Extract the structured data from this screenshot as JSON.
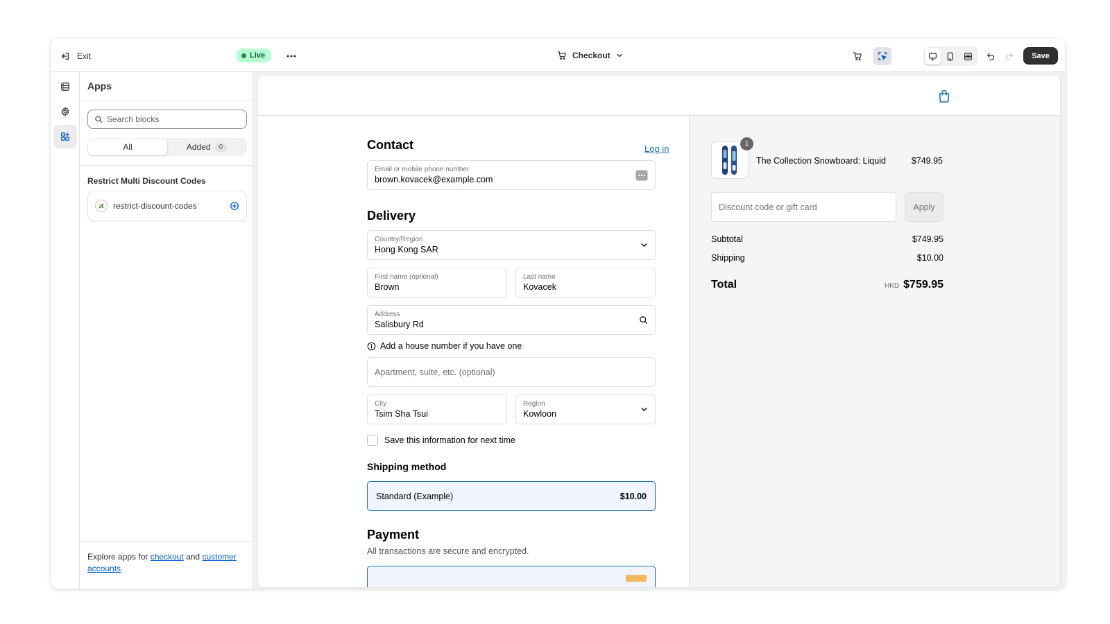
{
  "topbar": {
    "exit_label": "Exit",
    "status_label": "Live",
    "page_label": "Checkout",
    "save_label": "Save"
  },
  "sidebar": {
    "title": "Apps",
    "search_placeholder": "Search blocks",
    "tabs": [
      {
        "label": "All",
        "active": true
      },
      {
        "label": "Added",
        "count": "0"
      }
    ],
    "group_title": "Restrict Multi Discount Codes",
    "app_block": "restrict-discount-codes",
    "footer": {
      "prefix": "Explore apps for ",
      "link_checkout": "checkout",
      "middle": " and ",
      "link_customer": "customer accounts",
      "suffix": "."
    }
  },
  "checkout": {
    "contact": {
      "heading": "Contact",
      "login_link": "Log in",
      "email_label": "Email or mobile phone number",
      "email_value": "brown.kovacek@example.com"
    },
    "delivery": {
      "heading": "Delivery",
      "country_label": "Country/Region",
      "country_value": "Hong Kong SAR",
      "first_name_label": "First name (optional)",
      "first_name_value": "Brown",
      "last_name_label": "Last name",
      "last_name_value": "Kovacek",
      "address_label": "Address",
      "address_value": "Salisbury Rd",
      "address_hint": "Add a house number if you have one",
      "apartment_placeholder": "Apartment, suite, etc. (optional)",
      "city_label": "City",
      "city_value": "Tsim Sha Tsui",
      "region_label": "Region",
      "region_value": "Kowloon",
      "save_info_label": "Save this information for next time"
    },
    "shipping": {
      "heading": "Shipping method",
      "option_name": "Standard (Example)",
      "option_price": "$10.00"
    },
    "payment": {
      "heading": "Payment",
      "subtitle": "All transactions are secure and encrypted."
    }
  },
  "summary": {
    "product_qty": "1",
    "product_name": "The Collection Snowboard: Liquid",
    "product_price": "$749.95",
    "discount_placeholder": "Discount code or gift card",
    "apply_label": "Apply",
    "subtotal_label": "Subtotal",
    "subtotal_value": "$749.95",
    "shipping_label": "Shipping",
    "shipping_value": "$10.00",
    "total_label": "Total",
    "currency": "HKD",
    "total_value": "$759.95"
  },
  "colors": {
    "accent": "#1773b0",
    "live_bg": "#b4fed2",
    "save_bg": "#303030",
    "admin_link": "#005bd3"
  }
}
